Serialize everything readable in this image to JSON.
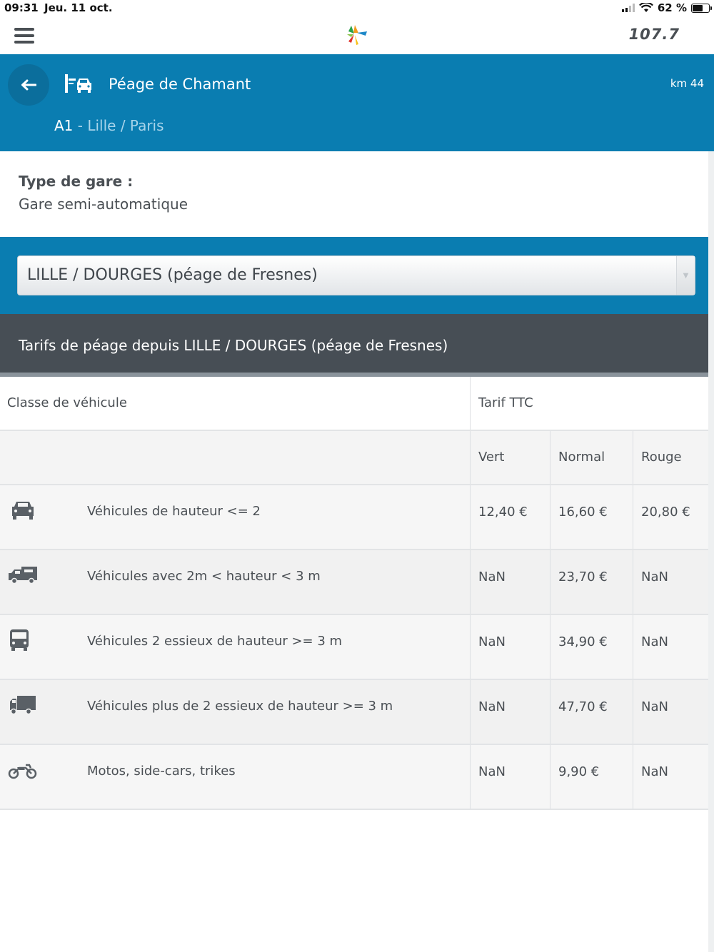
{
  "status_bar": {
    "time": "09:31",
    "date": "Jeu. 11 oct.",
    "battery": "62 %",
    "battery_level": 0.62
  },
  "app_bar": {
    "brand": "107.7"
  },
  "header": {
    "title": "Péage de Chamant",
    "km": "km 44",
    "road": "A1",
    "route": " - Lille / Paris"
  },
  "station": {
    "label": "Type de gare :",
    "value": "Gare semi-automatique"
  },
  "select": {
    "selected": "LILLE / DOURGES (péage de Fresnes)"
  },
  "tariff": {
    "heading": "Tarifs de péage depuis LILLE / DOURGES (péage de Fresnes)",
    "columns": {
      "vehicle_class": "Classe de véhicule",
      "tariff": "Tarif TTC",
      "green": "Vert",
      "normal": "Normal",
      "red": "Rouge"
    },
    "rows": [
      {
        "icon": "car-icon",
        "name": "Véhicules de hauteur <= 2",
        "green": "12,40 €",
        "normal": "16,60 €",
        "red": "20,80 €"
      },
      {
        "icon": "camper-icon",
        "name": "Véhicules avec 2m < hauteur < 3 m",
        "green": "NaN",
        "normal": "23,70 €",
        "red": "NaN"
      },
      {
        "icon": "bus-icon",
        "name": "Véhicules 2 essieux de hauteur >= 3 m",
        "green": "NaN",
        "normal": "34,90 €",
        "red": "NaN"
      },
      {
        "icon": "truck-icon",
        "name": "Véhicules plus de 2 essieux de hauteur >= 3 m",
        "green": "NaN",
        "normal": "47,70 €",
        "red": "NaN"
      },
      {
        "icon": "motorcycle-icon",
        "name": "Motos, side-cars, trikes",
        "green": "NaN",
        "normal": "9,90 €",
        "red": "NaN"
      }
    ]
  }
}
